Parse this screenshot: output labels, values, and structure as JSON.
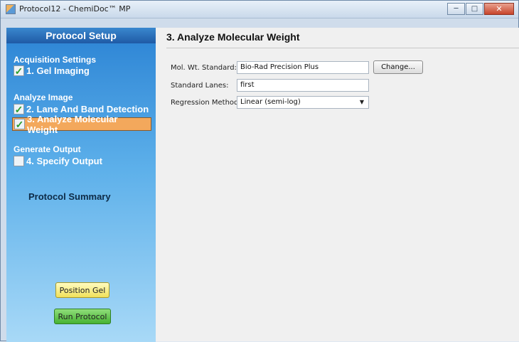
{
  "window": {
    "title": "Protocol12 - ChemiDoc™ MP"
  },
  "sidebar": {
    "header": "Protocol Setup",
    "groups": [
      {
        "title": "Acquisition Settings",
        "steps": [
          {
            "label": "1. Gel Imaging",
            "checked": true
          }
        ]
      },
      {
        "title": "Analyze Image",
        "steps": [
          {
            "label": "2. Lane And Band Detection",
            "checked": true
          },
          {
            "label": "3. Analyze Molecular Weight",
            "checked": true,
            "active": true
          }
        ]
      },
      {
        "title": "Generate Output",
        "steps": [
          {
            "label": "4. Specify Output",
            "checked": false
          }
        ]
      }
    ],
    "summary": "Protocol Summary",
    "position_gel_label": "Position Gel",
    "run_protocol_label": "Run Protocol"
  },
  "content": {
    "title": "3. Analyze Molecular Weight",
    "fields": {
      "mw_standard": {
        "label": "Mol. Wt. Standard:",
        "value": "Bio-Rad Precision Plus"
      },
      "standard_lanes": {
        "label": "Standard Lanes:",
        "value": "first"
      },
      "regression": {
        "label": "Regression Method:",
        "value": "Linear (semi-log)"
      }
    },
    "change_label": "Change..."
  },
  "colors": {
    "sidebar_top": "#2b83d4",
    "sidebar_bottom": "#a8d9f7",
    "active_step": "#f3a85c",
    "check_green": "#2a9c2a",
    "position_gel_btn": "#f1e15a",
    "run_protocol_btn": "#47b232"
  },
  "icons": {
    "app": "chemidoc-app-icon",
    "check": "check-icon",
    "dropdown": "chevron-down-icon",
    "minimize": "minimize-icon",
    "maximize": "maximize-icon",
    "close": "close-icon"
  }
}
